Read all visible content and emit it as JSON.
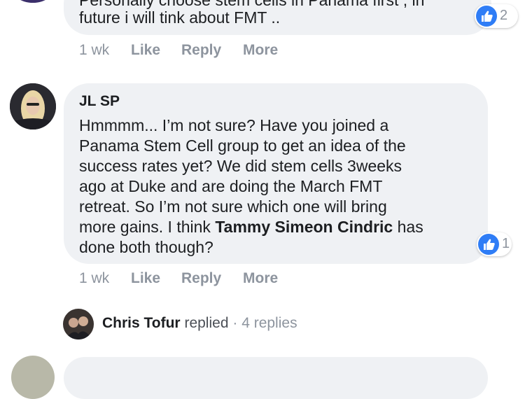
{
  "comment_prev": {
    "text_line1": "Personally choose stem cells in Panama first , in",
    "text_line2": "future i will tink about FMT ..",
    "reactions_count": "2",
    "time": "1 wk",
    "like_label": "Like",
    "reply_label": "Reply",
    "more_label": "More"
  },
  "comment_main": {
    "author": "JL SP",
    "lines": [
      "Hmmmm... I’m not sure? Have you joined a",
      "Panama Stem Cell group to get an idea of the",
      "success rates yet? We did stem cells 3weeks",
      "ago at Duke and are doing the March FMT",
      "retreat. So I’m not sure which one will bring",
      "more gains. I think "
    ],
    "mention": "Tammy Simeon Cindric",
    "line6_suffix": " has",
    "line7": "done both though?",
    "reactions_count": "1",
    "time": "1 wk",
    "like_label": "Like",
    "reply_label": "Reply",
    "more_label": "More"
  },
  "reply_summary": {
    "name": "Chris Tofur",
    "replied_label": "replied",
    "separator": "·",
    "count_label": "4 replies"
  }
}
